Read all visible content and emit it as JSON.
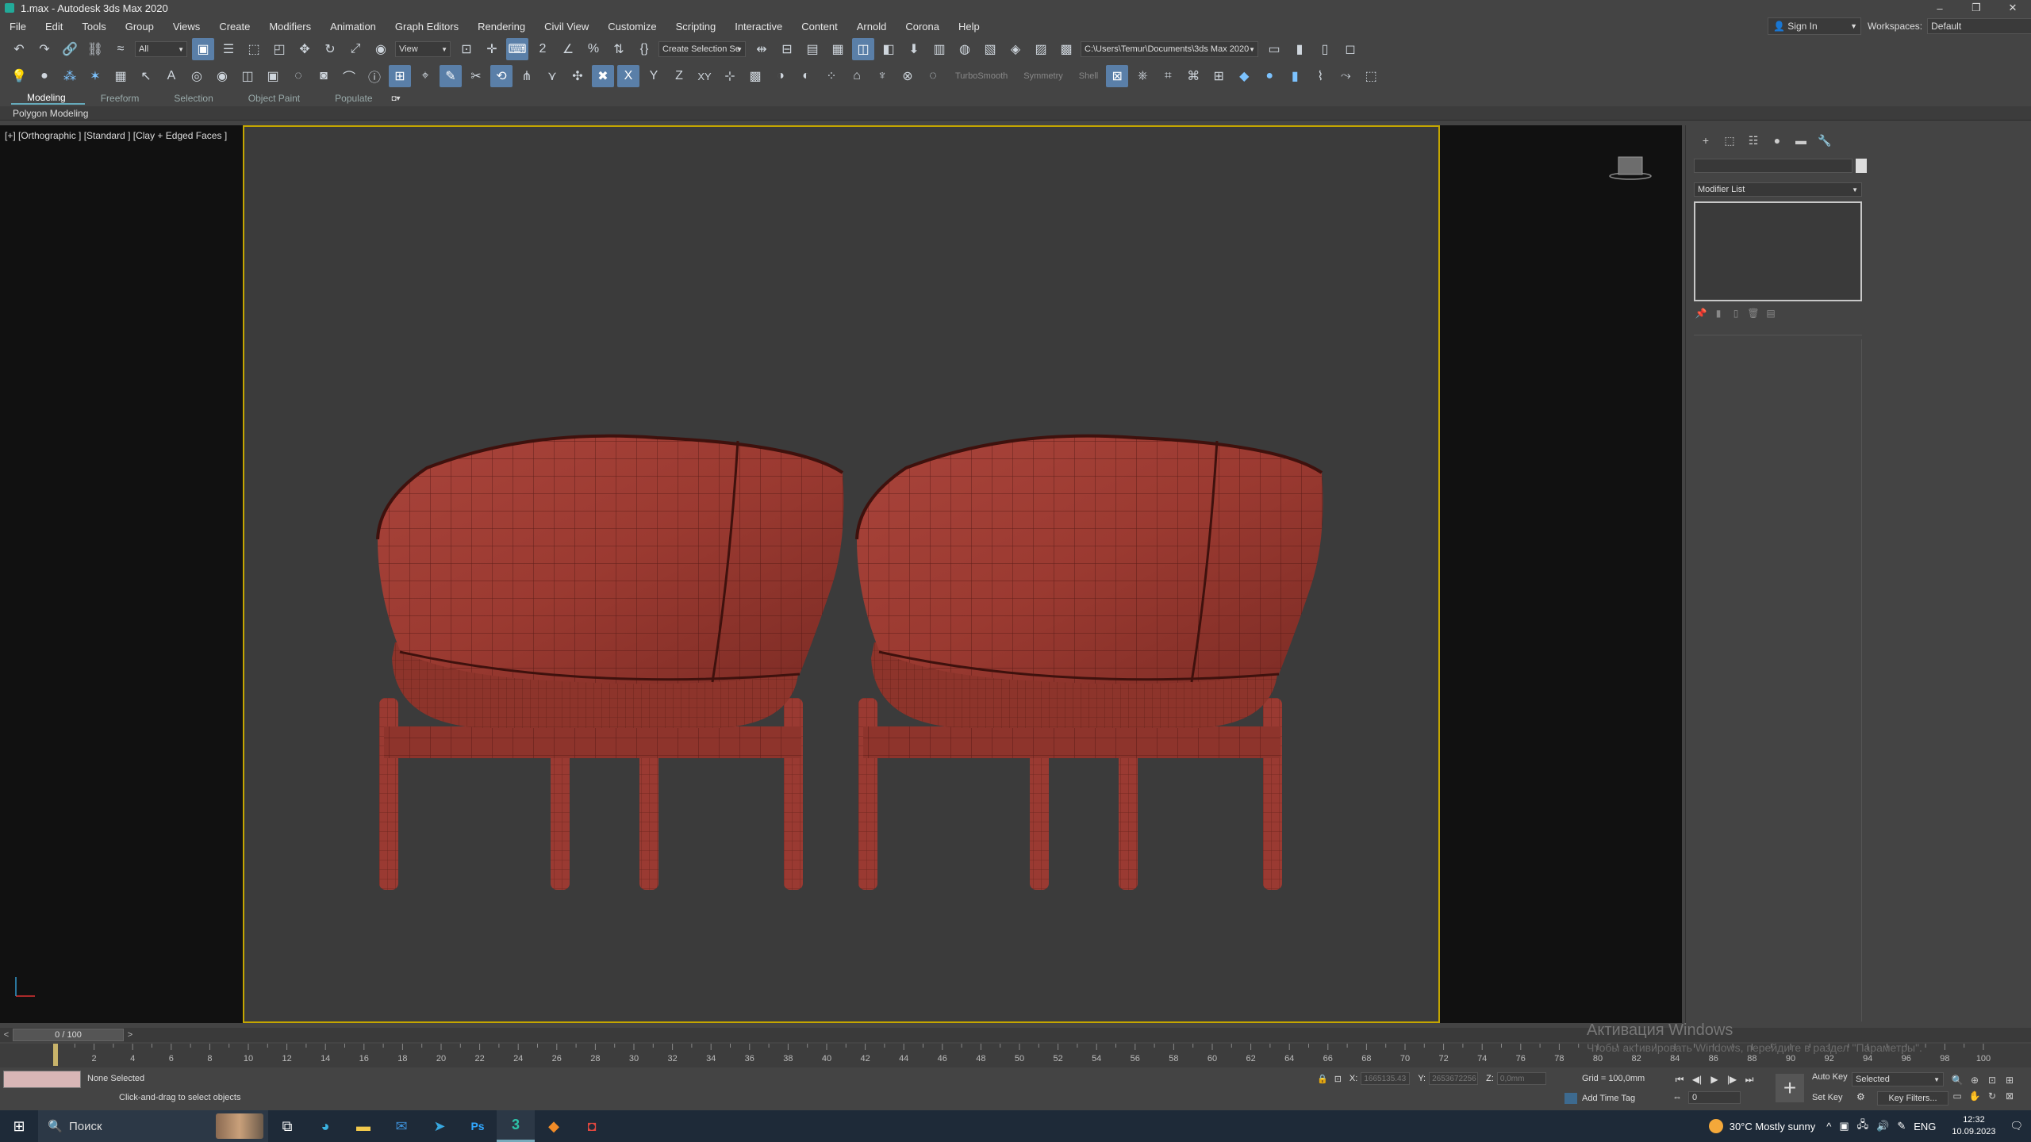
{
  "window": {
    "title": "1.max - Autodesk 3ds Max 2020",
    "controls": [
      "–",
      "❐",
      "✕"
    ]
  },
  "menu": [
    "File",
    "Edit",
    "Tools",
    "Group",
    "Views",
    "Create",
    "Modifiers",
    "Animation",
    "Graph Editors",
    "Rendering",
    "Civil View",
    "Customize",
    "Scripting",
    "Interactive",
    "Content",
    "Arnold",
    "Corona",
    "Help"
  ],
  "account": {
    "sign_in": "Sign In",
    "workspaces_label": "Workspaces:",
    "workspace_value": "Default"
  },
  "toolbar1": {
    "filter": "All",
    "ref_coord": "View",
    "selection_set": "Create Selection Se",
    "project_path": "C:\\Users\\Temur\\Documents\\3ds Max 2020"
  },
  "toolbar2": {
    "turbosmooth": "TurboSmooth",
    "symmetry": "Symmetry",
    "shell": "Shell",
    "axis_x": "X",
    "axis_y": "Y",
    "axis_z": "Z",
    "axis_xy": "XY"
  },
  "ribbon": {
    "tabs": [
      "Modeling",
      "Freeform",
      "Selection",
      "Object Paint",
      "Populate"
    ],
    "active_tab": "Modeling",
    "panel_label": "Polygon Modeling"
  },
  "viewport": {
    "label": "[+] [Orthographic ] [Standard ] [Clay + Edged Faces ]",
    "safe_frame_color": "#c4a600",
    "model_color": "#9e3a33"
  },
  "command_panel": {
    "modifier_list": "Modifier List"
  },
  "timeline": {
    "frame_counter": "0 / 100",
    "ticks": [
      "0",
      "2",
      "4",
      "6",
      "8",
      "10",
      "12",
      "14",
      "16",
      "18",
      "20",
      "22",
      "24",
      "26",
      "28",
      "30",
      "32",
      "34",
      "36",
      "38",
      "40",
      "42",
      "44",
      "46",
      "48",
      "50",
      "52",
      "54",
      "56",
      "58",
      "60",
      "62",
      "64",
      "66",
      "68",
      "70",
      "72",
      "74",
      "76",
      "78",
      "80",
      "82",
      "84",
      "86",
      "88",
      "90",
      "92",
      "94",
      "96",
      "98",
      "100"
    ]
  },
  "watermark": {
    "line1": "Активация Windows",
    "line2": "Чтобы активировать Windows, перейдите в раздел \"Параметры\"."
  },
  "status": {
    "selection": "None Selected",
    "prompt": "Click-and-drag to select objects",
    "x_label": "X:",
    "x_value": "1665135.43",
    "y_label": "Y:",
    "y_value": "2653672256",
    "z_label": "Z:",
    "z_value": "0,0mm",
    "grid": "Grid = 100,0mm",
    "add_time_tag": "Add Time Tag",
    "auto_key": "Auto Key",
    "set_key": "Set Key",
    "key_mode": "Selected",
    "key_filters": "Key Filters...",
    "frame": "0"
  },
  "taskbar": {
    "search_placeholder": "Поиск",
    "weather": "30°C  Mostly sunny",
    "lang": "ENG",
    "time": "12:32",
    "date": "10.09.2023"
  }
}
